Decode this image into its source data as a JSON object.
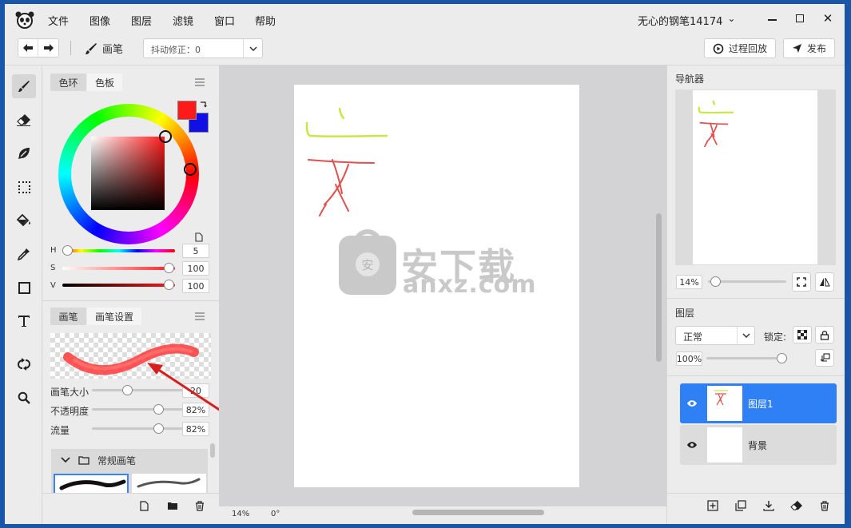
{
  "menu": [
    "文件",
    "图像",
    "图层",
    "滤镜",
    "窗口",
    "帮助"
  ],
  "user": {
    "name": "无心的钢笔14174",
    "caret": "⌄"
  },
  "toolbar": {
    "tool_label": "画笔",
    "stabilizer": "抖动修正：0",
    "replay_label": "过程回放",
    "publish_label": "发布"
  },
  "color_panel": {
    "tabs": [
      "色环",
      "色板"
    ],
    "primary_color": "#ff1a1a",
    "secondary_color": "#1010e6",
    "h_label": "H",
    "h_value": "5",
    "s_label": "S",
    "s_value": "100",
    "v_label": "V",
    "v_value": "100"
  },
  "brush_panel": {
    "tabs": [
      "画笔",
      "画笔设置"
    ],
    "size_label": "画笔大小",
    "size_value": "20",
    "opacity_label": "不透明度",
    "opacity_value": "82%",
    "flow_label": "流量",
    "flow_value": "82%",
    "group_label": "常规画笔"
  },
  "canvas": {
    "zoom": "14%",
    "rotation": "0°",
    "watermark_cn": "安下载",
    "watermark_en": "anxz.com",
    "watermark_badge": "安"
  },
  "navigator": {
    "title": "导航器",
    "zoom": "14%"
  },
  "layers_panel": {
    "title": "图层",
    "blend_mode": "正常",
    "lock_label": "锁定:",
    "opacity": "100%",
    "layers": [
      {
        "name": "图层1",
        "selected": true
      },
      {
        "name": "背景",
        "selected": false
      }
    ]
  }
}
